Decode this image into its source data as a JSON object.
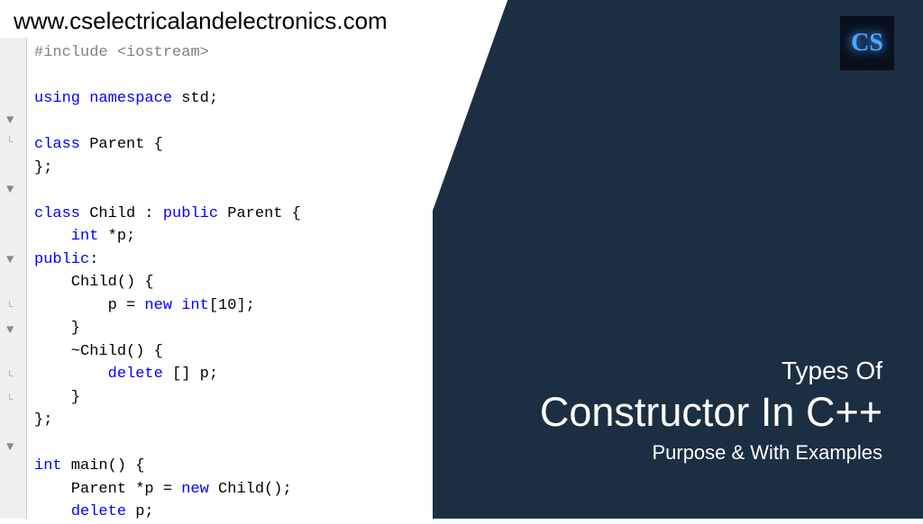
{
  "url": "www.cselectricalandelectronics.com",
  "logo_text": "CS",
  "code": {
    "line1_kw": "#include",
    "line1_rest": " <iostream>",
    "line3_using": "using ",
    "line3_namespace": "namespace",
    "line3_std": " std;",
    "line5_class": "class",
    "line5_parent": " Parent {",
    "line6": "};",
    "line8_class": "class",
    "line8_child": " Child : ",
    "line8_public": "public",
    "line8_parent2": " Parent {",
    "line9_int": "    int",
    "line9_p": " *p;",
    "line10_public": "public",
    "line10_colon": ":",
    "line11": "    Child() {",
    "line12_pre": "        p = ",
    "line12_new": "new",
    "line12_int": " int",
    "line12_post": "[10];",
    "line13": "    }",
    "line14": "    ~Child() {",
    "line15_pre": "        ",
    "line15_delete": "delete",
    "line15_post": " [] p;",
    "line16": "    }",
    "line17": "};",
    "line19_int": "int",
    "line19_main": " main() {",
    "line20_pre": "    Parent *p = ",
    "line20_new": "new",
    "line20_post": " Child();",
    "line21_pre": "    ",
    "line21_delete": "delete",
    "line21_post": " p;"
  },
  "title": {
    "small": "Types Of",
    "big": "Constructor In C++",
    "sub": "Purpose & With Examples"
  }
}
